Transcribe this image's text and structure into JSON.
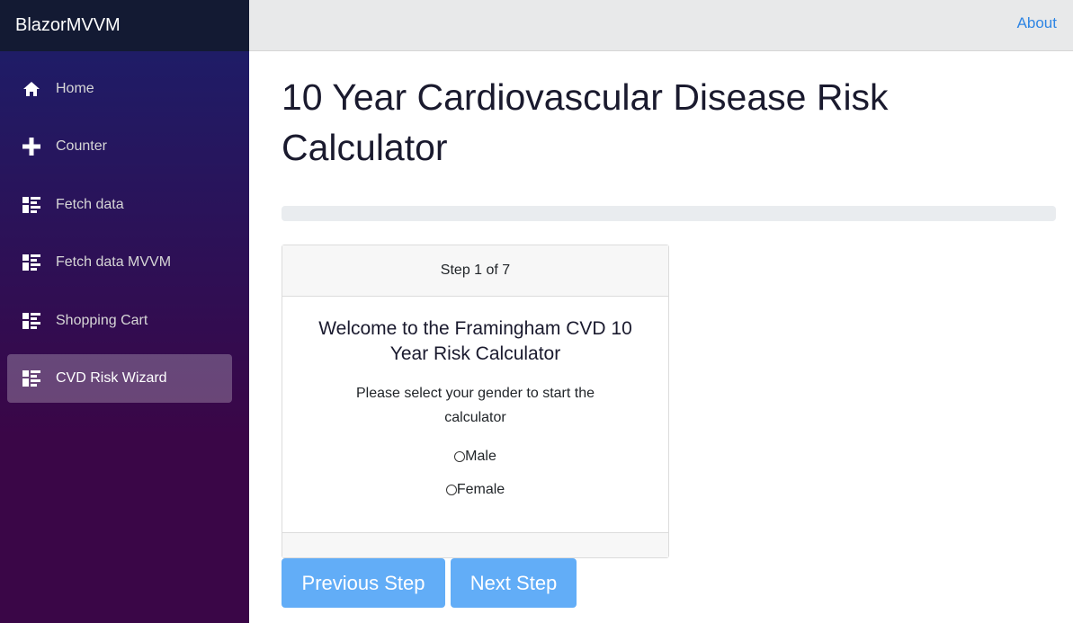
{
  "brand": "BlazorMVVM",
  "top_row": {
    "about_label": "About"
  },
  "sidebar": {
    "items": [
      {
        "label": "Home",
        "icon": "home-icon",
        "active": false
      },
      {
        "label": "Counter",
        "icon": "plus-icon",
        "active": false
      },
      {
        "label": "Fetch data",
        "icon": "list-rich-icon",
        "active": false
      },
      {
        "label": "Fetch data MVVM",
        "icon": "list-rich-icon",
        "active": false
      },
      {
        "label": "Shopping Cart",
        "icon": "list-rich-icon",
        "active": false
      },
      {
        "label": "CVD Risk Wizard",
        "icon": "list-rich-icon",
        "active": true
      }
    ]
  },
  "main": {
    "title": "10 Year Cardiovascular Disease Risk Calculator",
    "progress": 0,
    "card": {
      "header": "Step 1 of 7",
      "title": "Welcome to the Framingham CVD 10 Year Risk Calculator",
      "text": "Please select your gender to start the calculator",
      "options": [
        "Male",
        "Female"
      ]
    },
    "buttons": {
      "previous": "Previous Step",
      "next": "Next Step"
    }
  },
  "colors": {
    "sidebar_top": "#1b1f6b",
    "sidebar_bottom": "#3a0647",
    "link": "#2f86e4",
    "button": "#62adf7"
  }
}
